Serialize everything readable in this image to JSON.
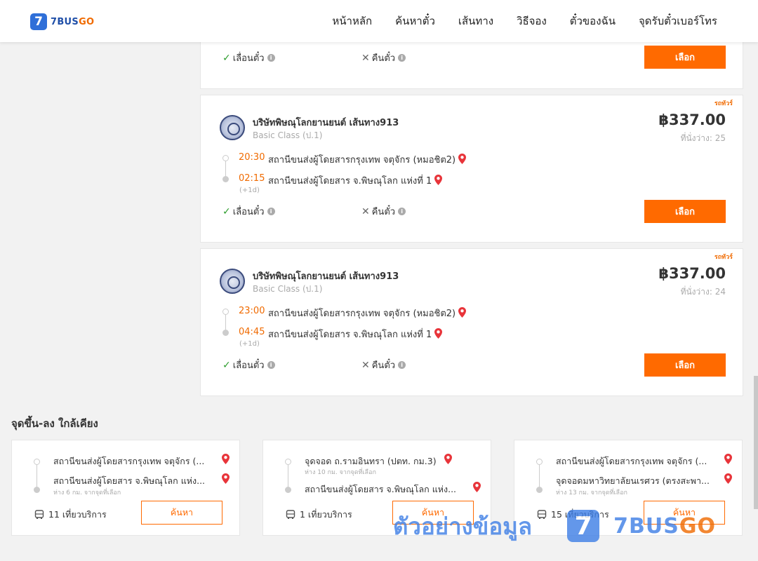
{
  "header": {
    "logo_mark": "7",
    "logo_text_main": "7BUS",
    "logo_text_accent": "GO",
    "nav": [
      "หน้าหลัก",
      "ค้นหาตั๋ว",
      "เส้นทาง",
      "วิธีจอง",
      "ตั๋วของฉัน",
      "จุดรับตั๋วเบอร์โทร"
    ]
  },
  "top_card": {
    "opt_change": "เลื่อนตั๋ว",
    "opt_refund": "คืนตั๋ว",
    "select_label": "เลือก"
  },
  "trips": [
    {
      "badge": "รถทัวร์",
      "operator": "บริษัทพิษณุโลกยานยนต์ เส้นทาง913",
      "bus_class": "Basic Class (ป.1)",
      "price": "฿337.00",
      "seats": "ที่นั่งว่าง: 25",
      "depart_time": "20:30",
      "depart_stop": "สถานีขนส่งผู้โดยสารกรุงเทพ จตุจักร (หมอชิต2)",
      "arrive_time": "02:15",
      "arrive_stop": "สถานีขนส่งผู้โดยสาร จ.พิษณุโลก แห่งที่ 1",
      "next_day": "(+1d)",
      "opt_change": "เลื่อนตั๋ว",
      "opt_refund": "คืนตั๋ว",
      "select_label": "เลือก"
    },
    {
      "badge": "รถทัวร์",
      "operator": "บริษัทพิษณุโลกยานยนต์ เส้นทาง913",
      "bus_class": "Basic Class (ป.1)",
      "price": "฿337.00",
      "seats": "ที่นั่งว่าง: 24",
      "depart_time": "23:00",
      "depart_stop": "สถานีขนส่งผู้โดยสารกรุงเทพ จตุจักร (หมอชิต2)",
      "arrive_time": "04:45",
      "arrive_stop": "สถานีขนส่งผู้โดยสาร จ.พิษณุโลก แห่งที่ 1",
      "next_day": "(+1d)",
      "opt_change": "เลื่อนตั๋ว",
      "opt_refund": "คืนตั๋ว",
      "select_label": "เลือก"
    }
  ],
  "nearby": {
    "title": "จุดขึ้น-ลง ใกล้เคียง",
    "cards": [
      {
        "from": "สถานีขนส่งผู้โดยสารกรุงเทพ จตุจักร (...",
        "from_dist": "",
        "to": "สถานีขนส่งผู้โดยสาร จ.พิษณุโลก แห่ง...",
        "to_dist": "ห่าง 6 กม. จากจุดที่เลือก",
        "trips": "11 เที่ยวบริการ",
        "search_label": "ค้นหา"
      },
      {
        "from": "จุดจอด ถ.รามอินทรา (ปตท. กม.3)",
        "from_dist": "ห่าง 10 กม. จากจุดที่เลือก",
        "to": "สถานีขนส่งผู้โดยสาร จ.พิษณุโลก แห่ง...",
        "to_dist": "",
        "trips": "1 เที่ยวบริการ",
        "search_label": "ค้นหา"
      },
      {
        "from": "สถานีขนส่งผู้โดยสารกรุงเทพ จตุจักร (...",
        "from_dist": "",
        "to": "จุดจอดมหาวิทยาลัยนเรศวร (ตรงสะพา...",
        "to_dist": "ห่าง 13 กม. จากจุดที่เลือก",
        "trips": "15 เที่ยวบริการ",
        "search_label": "ค้นหา"
      }
    ]
  },
  "watermark": {
    "text": "ตัวอย่างข้อมูล",
    "mark": "7",
    "brand_main": "7BUS",
    "brand_accent": "GO"
  },
  "colors": {
    "accent": "#ff6a00",
    "brand_blue": "#2f6fd8",
    "check_green": "#2e9d2e"
  }
}
